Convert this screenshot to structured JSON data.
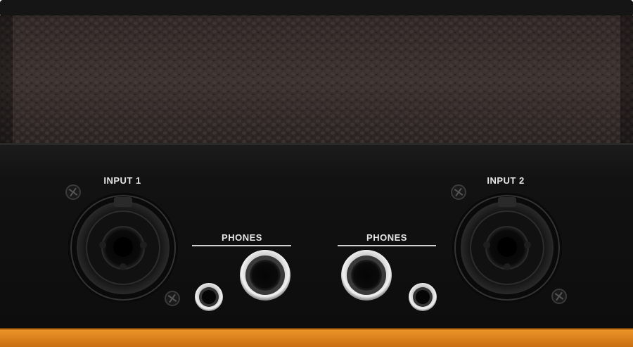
{
  "panel": {
    "labels": {
      "input1": "INPUT 1",
      "input2": "INPUT 2",
      "phones_left": "PHONES",
      "phones_right": "PHONES"
    }
  },
  "colors": {
    "leather": "#3b3230",
    "panel": "#141414",
    "trim": "#e0861d",
    "text": "#e6e6e6",
    "chrome": "#c9c9c9"
  },
  "icons": {
    "combo_jack": "xlr-combo-jack-icon",
    "phone_jack": "quarter-inch-jack-icon",
    "mini_jack": "eighth-inch-jack-icon",
    "screw": "screw-icon"
  }
}
